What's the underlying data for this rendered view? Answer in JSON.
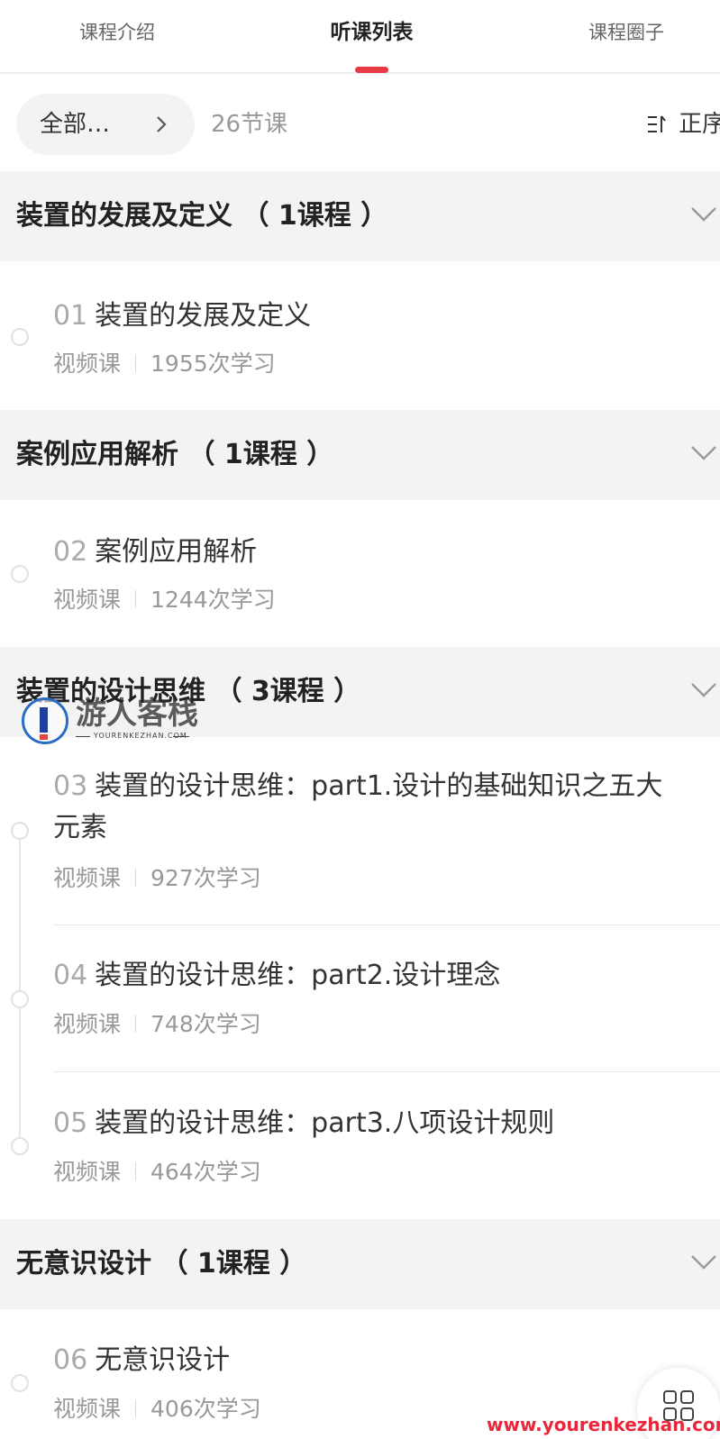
{
  "tabs": [
    {
      "label": "课程介绍"
    },
    {
      "label": "听课列表"
    },
    {
      "label": "课程圈子"
    }
  ],
  "accent_color": "#e83a45",
  "filter": {
    "label": "全部…",
    "count": "26节课",
    "sort_label": "正序",
    "sort_icon": "sort-icon"
  },
  "sections": [
    {
      "title": "装置的发展及定义 （ 1课程 ）",
      "lessons": [
        {
          "num": "01",
          "title": "装置的发展及定义",
          "type": "视频课",
          "views": "1955次学习"
        }
      ]
    },
    {
      "title": "案例应用解析 （ 1课程 ）",
      "lessons": [
        {
          "num": "02",
          "title": "案例应用解析",
          "type": "视频课",
          "views": "1244次学习"
        }
      ]
    },
    {
      "title": "装置的设计思维 （ 3课程 ）",
      "lessons": [
        {
          "num": "03",
          "title": "装置的设计思维：part1.设计的基础知识之五大元素",
          "type": "视频课",
          "views": "927次学习"
        },
        {
          "num": "04",
          "title": "装置的设计思维：part2.设计理念",
          "type": "视频课",
          "views": "748次学习"
        },
        {
          "num": "05",
          "title": "装置的设计思维：part3.八项设计规则",
          "type": "视频课",
          "views": "464次学习"
        }
      ]
    },
    {
      "title": "无意识设计 （ 1课程 ）",
      "lessons": [
        {
          "num": "06",
          "title": "无意识设计",
          "type": "视频课",
          "views": "406次学习"
        }
      ]
    }
  ],
  "watermark": {
    "name": "游人客栈",
    "sub": "YOURENKEZHAN.COM",
    "url": "www.yourenkezhan.com"
  },
  "fab_icon": "grid-icon"
}
